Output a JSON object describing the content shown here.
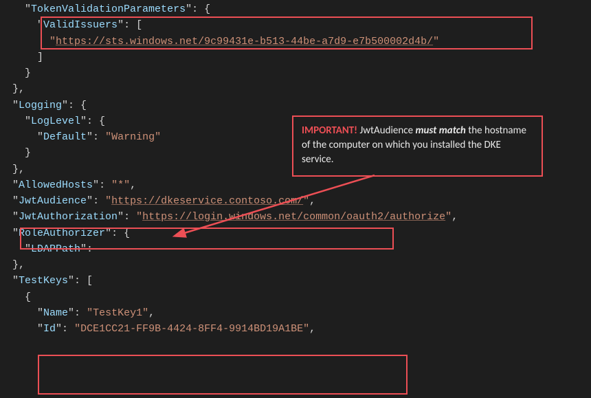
{
  "code": {
    "tokenValidationParameters": {
      "key": "TokenValidationParameters",
      "validIssuersKey": "ValidIssuers",
      "validIssuers": [
        "https://sts.windows.net/9c99431e-b513-44be-a7d9-e7b500002d4b/"
      ]
    },
    "logging": {
      "key": "Logging",
      "logLevelKey": "LogLevel",
      "defaultKey": "Default",
      "defaultValue": "Warning"
    },
    "allowedHosts": {
      "key": "AllowedHosts",
      "value": "*"
    },
    "jwtAudience": {
      "key": "JwtAudience",
      "value": "https://dkeservice.contoso.com/"
    },
    "jwtAuthorization": {
      "key": "JwtAuthorization",
      "value": "https://login.windows.net/common/oauth2/authorize"
    },
    "roleAuthorizer": {
      "key": "RoleAuthorizer",
      "ldapPathKey": "LDAPPath"
    },
    "testKeys": {
      "key": "TestKeys",
      "items": [
        {
          "nameKey": "Name",
          "nameValue": "TestKey1",
          "idKey": "Id",
          "idValue": "DCE1CC21-FF9B-4424-8FF4-9914BD19A1BE"
        }
      ]
    }
  },
  "callout": {
    "important": "IMPORTANT!",
    "text1": " JwtAudience ",
    "emph": "must match",
    "text2": " the hostname of the computer on which you installed the DKE service."
  }
}
